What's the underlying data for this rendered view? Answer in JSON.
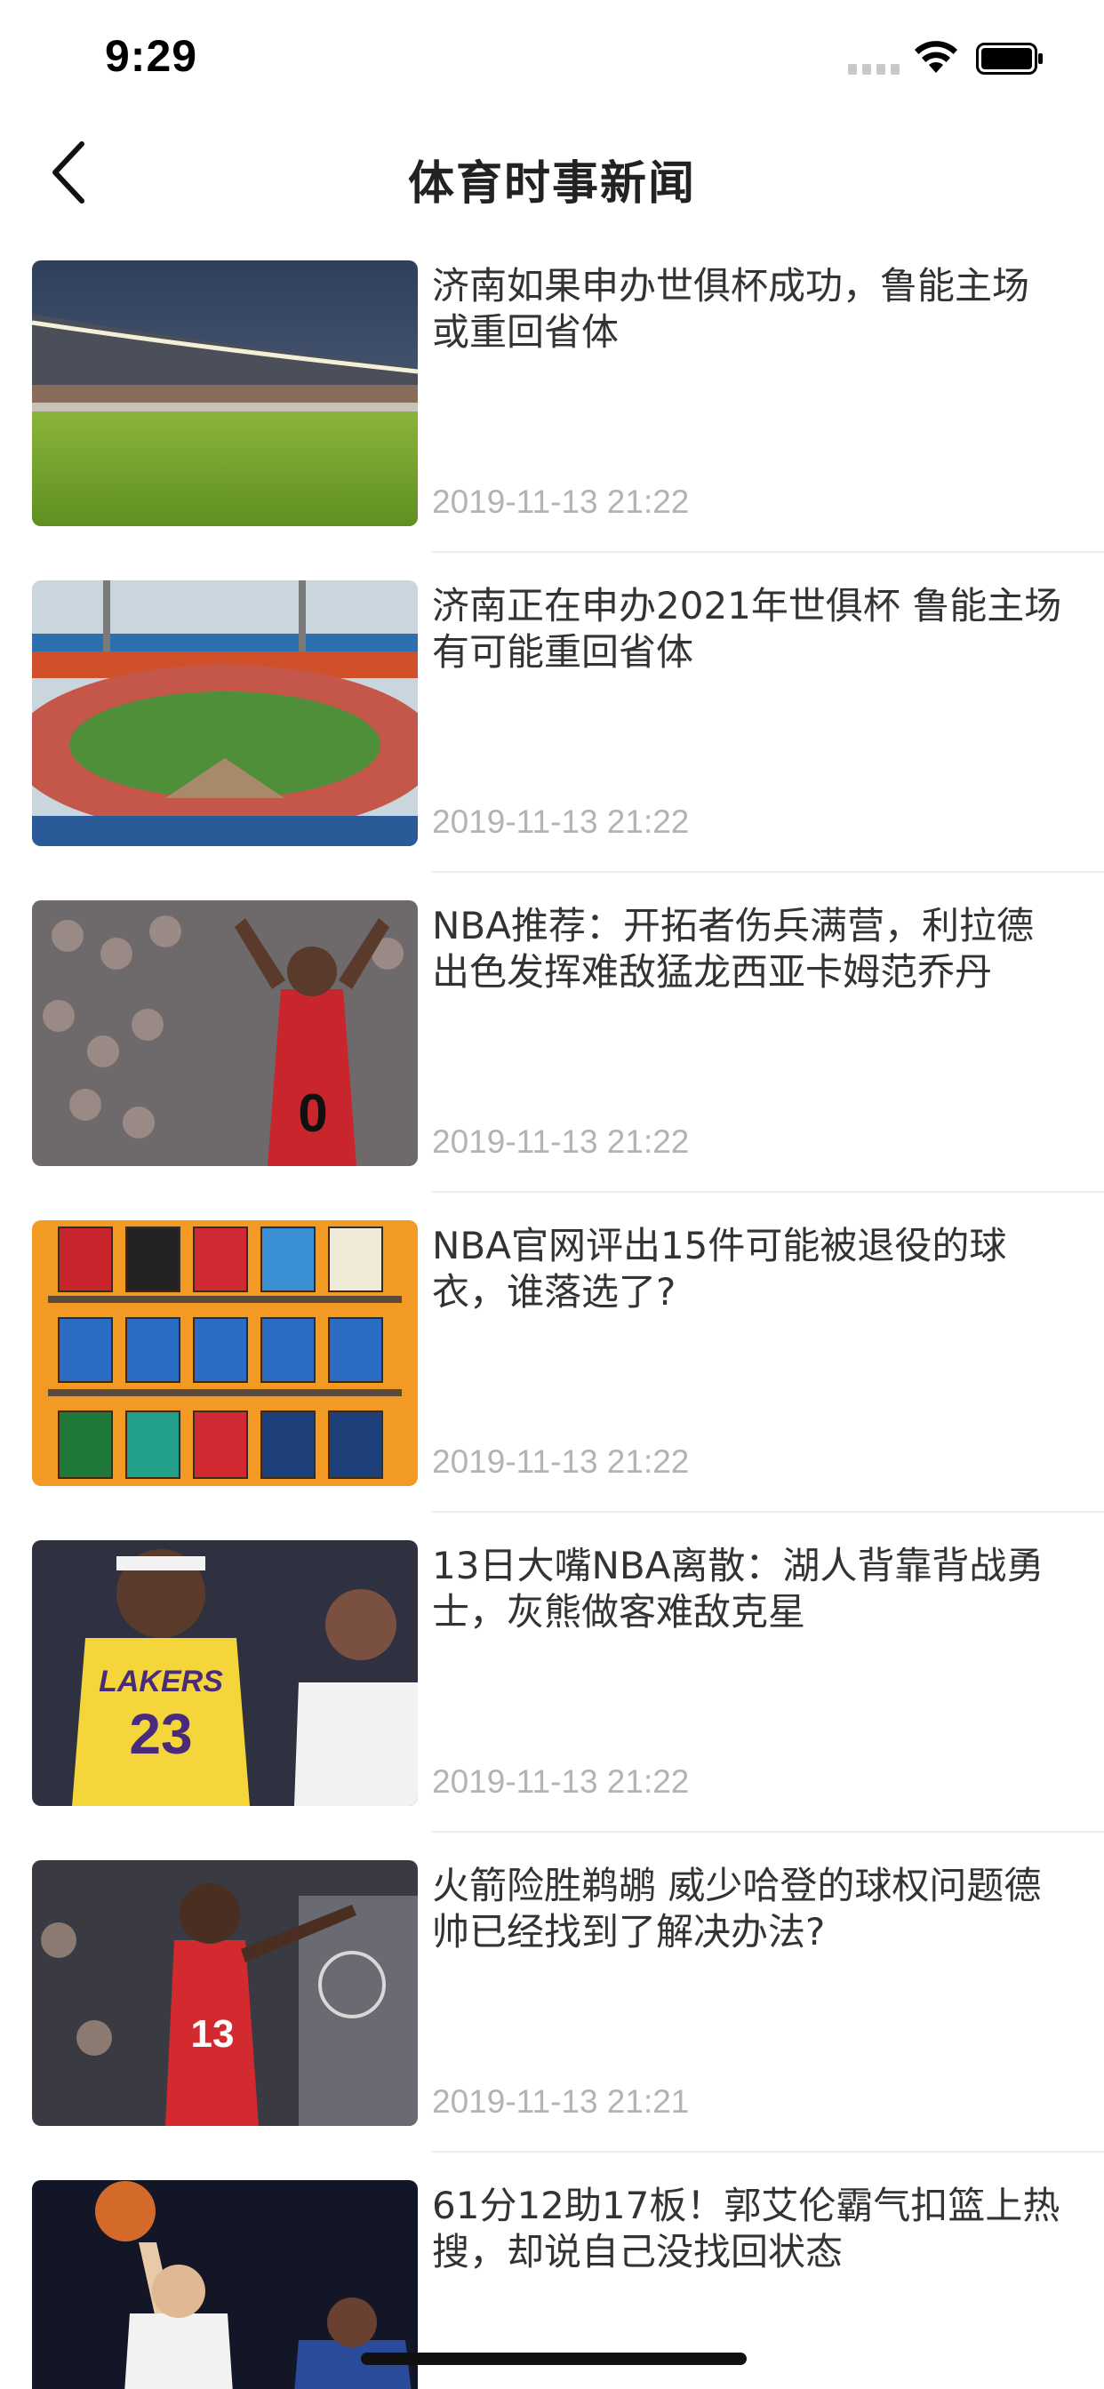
{
  "status_bar": {
    "time": "9:29"
  },
  "nav": {
    "title": "体育时事新闻"
  },
  "news": [
    {
      "title": "济南如果申办世俱杯成功，鲁能主场或重回省体",
      "time": "2019-11-13 21:22",
      "image": "stadium-grass"
    },
    {
      "title": "济南正在申办2021年世俱杯 鲁能主场有可能重回省体",
      "time": "2019-11-13 21:22",
      "image": "stadium-aerial"
    },
    {
      "title": "NBA推荐：开拓者伤兵满营，利拉德出色发挥难敌猛龙西亚卡姆范乔丹",
      "time": "2019-11-13 21:22",
      "image": "lillard-player"
    },
    {
      "title": "NBA官网评出15件可能被退役的球衣，谁落选了?",
      "time": "2019-11-13 21:22",
      "image": "jerseys-grid"
    },
    {
      "title": "13日大嘴NBA离散：湖人背靠背战勇士，灰熊做客难敌克星",
      "time": "2019-11-13 21:22",
      "image": "lakers-warriors"
    },
    {
      "title": "火箭险胜鹈鹕 威少哈登的球权问题德帅已经找到了解决办法?",
      "time": "2019-11-13 21:21",
      "image": "rockets-harden"
    },
    {
      "title": "61分12助17板！郭艾伦霸气扣篮上热搜，却说自己没找回状态",
      "time": "",
      "image": "cba-dunk"
    }
  ],
  "colors": {
    "title_text": "#333333",
    "time_text": "#b3b3b3",
    "divider": "#eeeeee"
  }
}
